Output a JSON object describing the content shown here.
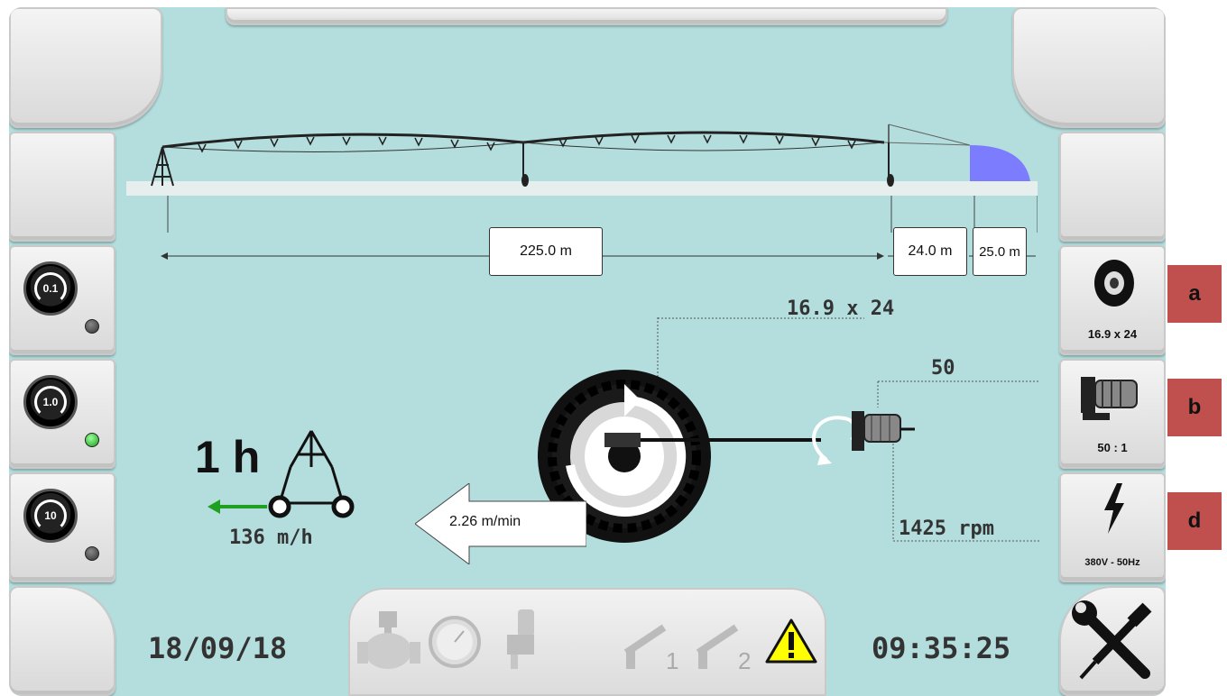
{
  "span": {
    "main_length": "225.0 m",
    "overhang_length": "24.0 m",
    "endgun_length": "25.0 m",
    "endgun_color": "#7c7cff"
  },
  "left_buttons": [
    {
      "value": "0.1",
      "led": "off"
    },
    {
      "value": "1.0",
      "led": "on"
    },
    {
      "value": "10",
      "led": "off"
    }
  ],
  "right_buttons": {
    "tire": {
      "label": "16.9 x 24",
      "icon": "tire-icon"
    },
    "gearbox": {
      "label": "50 : 1",
      "icon": "gearbox-icon"
    },
    "power": {
      "label": "380V - 50Hz",
      "icon": "lightning-icon"
    },
    "tools": {
      "icon": "wrench-screwdriver-icon"
    }
  },
  "drive": {
    "tire_size": "16.9 x 24",
    "gear_ratio": "50",
    "motor_rpm": "1425 rpm",
    "speed": "2.26 m/min"
  },
  "pivot": {
    "time": "1 h",
    "speed": "136 m/h"
  },
  "status": {
    "date": "18/09/18",
    "time": "09:35:25",
    "gun1": "1",
    "gun2": "2",
    "warning_color": "#ffff00"
  },
  "tags": {
    "a": "a",
    "b": "b",
    "d": "d"
  }
}
